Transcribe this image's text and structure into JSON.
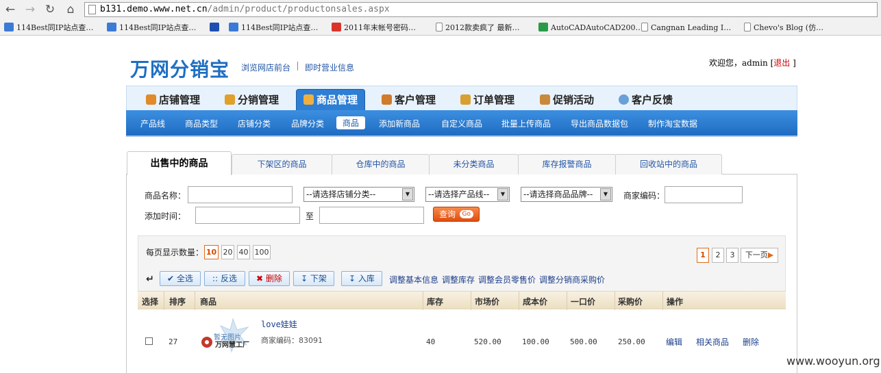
{
  "browser": {
    "url_host": "b131.demo.www.net.cn",
    "url_path": "/admin/product/productonsales.aspx",
    "bookmarks": [
      {
        "label": "114Best同IP站点查…",
        "icon": "phone-icon"
      },
      {
        "label": "114Best同IP站点查…",
        "icon": "phone-icon"
      },
      {
        "label": "",
        "icon": "paw-icon"
      },
      {
        "label": "114Best同IP站点查…",
        "icon": "phone-icon"
      },
      {
        "label": "2011年末帐号密码…",
        "icon": "calendar-icon"
      },
      {
        "label": "2012款卖疯了 最新…",
        "icon": "page-icon"
      },
      {
        "label": "AutoCADAutoCAD200…",
        "icon": "autocad-icon"
      },
      {
        "label": "Cangnan Leading I…",
        "icon": "page-icon"
      },
      {
        "label": "Chevo's Blog (仿…",
        "icon": "page-icon"
      }
    ]
  },
  "header": {
    "logo": "万网分销宝",
    "link_front": "浏览网店前台",
    "link_info": "即时营业信息",
    "welcome": "欢迎您，admin [",
    "logout": "退出",
    "welcome_end": " ]"
  },
  "mainnav": [
    {
      "label": "店铺管理",
      "icon": "home-icon"
    },
    {
      "label": "分销管理",
      "icon": "users-icon"
    },
    {
      "label": "商品管理",
      "icon": "box-icon"
    },
    {
      "label": "客户管理",
      "icon": "card-icon"
    },
    {
      "label": "订单管理",
      "icon": "people-icon"
    },
    {
      "label": "促销活动",
      "icon": "note-icon"
    },
    {
      "label": "客户反馈",
      "icon": "chat-icon"
    }
  ],
  "subnav": [
    "产品线",
    "商品类型",
    "店铺分类",
    "品牌分类",
    "商品",
    "添加新商品",
    "自定义商品",
    "批量上传商品",
    "导出商品数据包",
    "制作淘宝数据"
  ],
  "tabs": [
    "出售中的商品",
    "下架区的商品",
    "仓库中的商品",
    "未分类商品",
    "库存报警商品",
    "回收站中的商品"
  ],
  "search": {
    "name_label": "商品名称：",
    "shop_cat": "--请选择店铺分类--",
    "product_line": "--请选择产品线--",
    "brand": "--请选择商品品牌--",
    "code_label": "商家编码：",
    "time_label": "添加时间：",
    "to": "至",
    "query": "查询",
    "go": "Go"
  },
  "list": {
    "per_page_label": "每页显示数量：",
    "per_page": [
      "10",
      "20",
      "40",
      "100"
    ],
    "pages": [
      "1",
      "2",
      "3"
    ],
    "next": "下一页",
    "actions": [
      "全选",
      "反选",
      "删除",
      "下架",
      "入库"
    ],
    "links": [
      "调整基本信息",
      "调整库存",
      "调整会员零售价",
      "调整分销商采购价"
    ]
  },
  "table": {
    "headers": [
      "选择",
      "排序",
      "商品",
      "库存",
      "市场价",
      "成本价",
      "一口价",
      "采购价",
      "操作"
    ],
    "row": {
      "sort": "27",
      "name": "love娃娃",
      "code": "商家编码：83091",
      "stock": "40",
      "market": "520.00",
      "cost": "100.00",
      "price": "500.00",
      "purchase": "250.00",
      "ops": [
        "编辑",
        "相关商品",
        "删除"
      ],
      "img_text1": "暂无图片",
      "img_text2": "万网慧工厂"
    }
  },
  "watermark": "www.wooyun.org"
}
